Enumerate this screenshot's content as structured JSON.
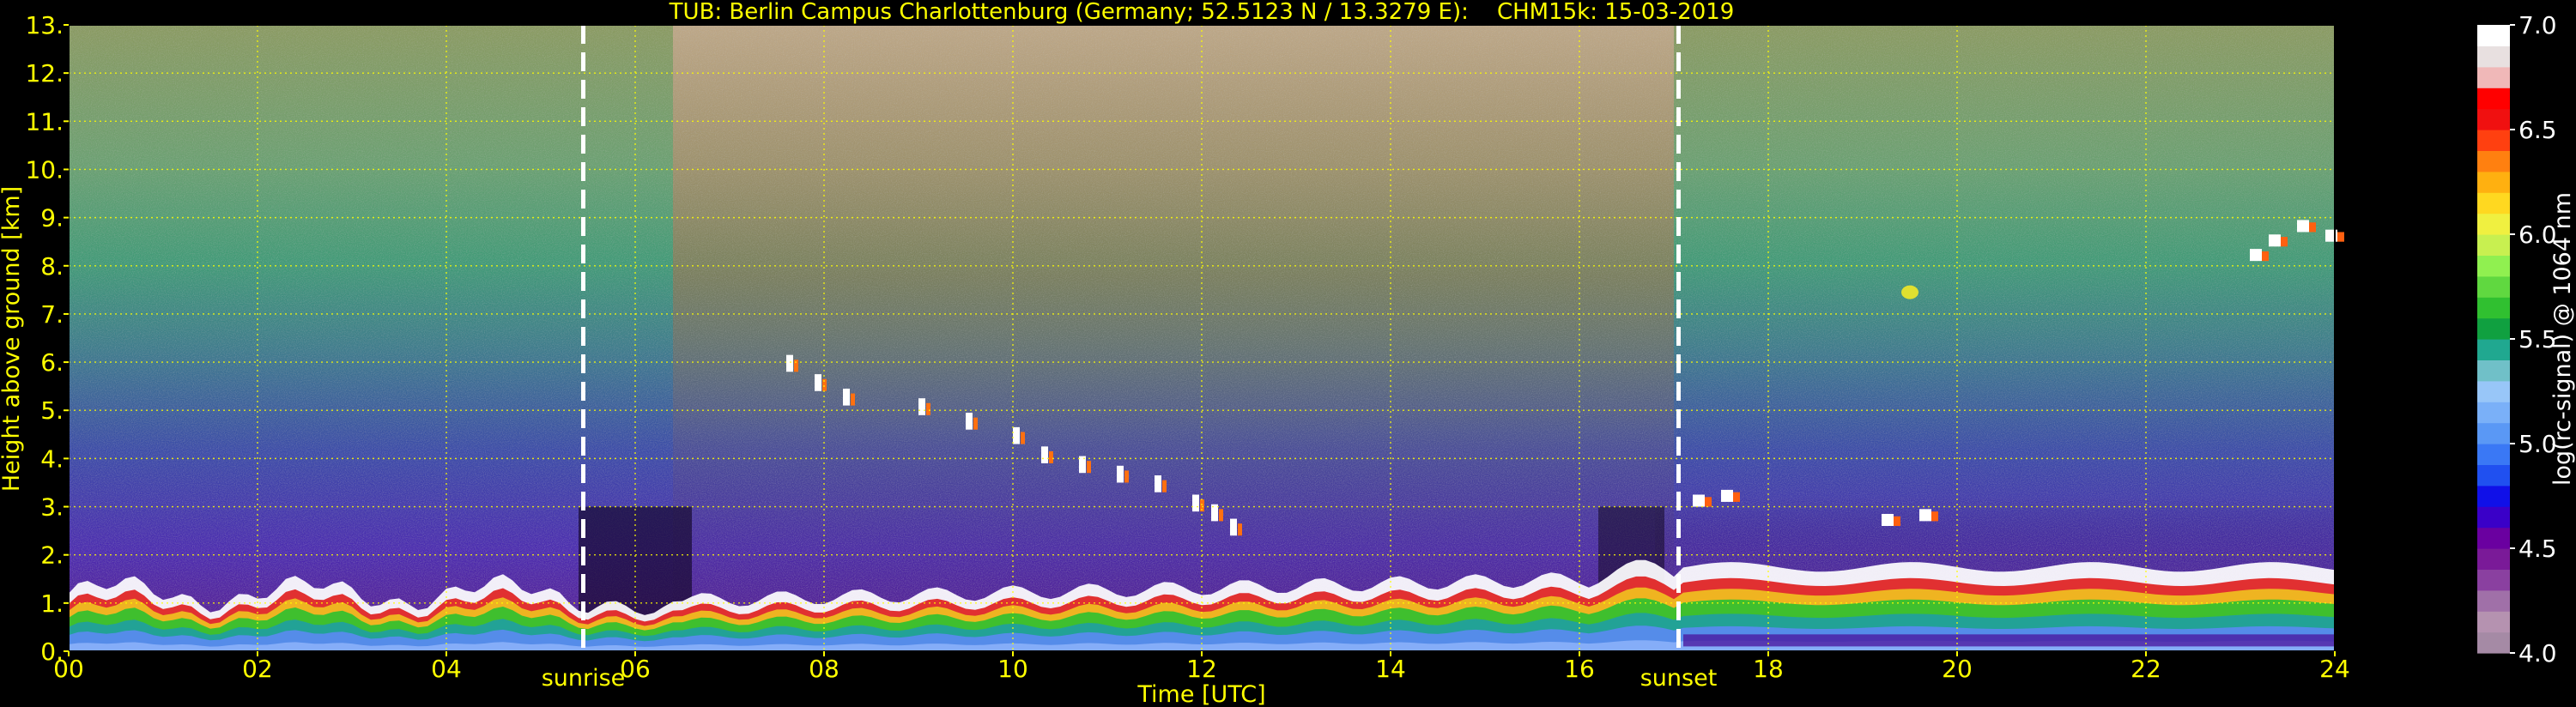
{
  "chart_data": {
    "type": "heatmap",
    "title": "TUB: Berlin Campus Charlottenburg (Germany; 52.5123 N / 13.3279 E):    CHM15k: 15-03-2019",
    "xlabel": "Time [UTC]",
    "ylabel": "Height above ground [km]",
    "xlim": [
      0,
      24
    ],
    "ylim": [
      0,
      13
    ],
    "x_ticks": [
      "00",
      "02",
      "04",
      "06",
      "08",
      "10",
      "12",
      "14",
      "16",
      "18",
      "20",
      "22",
      "24"
    ],
    "y_ticks": [
      "0.",
      "1.",
      "2.",
      "3.",
      "4.",
      "5.",
      "6.",
      "7.",
      "8.",
      "9.",
      "10.",
      "11.",
      "12.",
      "13."
    ],
    "grid": true,
    "colorbar": {
      "label": "log(rc-signal) @ 1064 nm",
      "range": [
        4.0,
        7.0
      ],
      "ticks": [
        "4.0",
        "4.5",
        "5.0",
        "5.5",
        "6.0",
        "6.5",
        "7.0"
      ],
      "colors": [
        "#a58aa5",
        "#b592b0",
        "#a070a8",
        "#8a40a0",
        "#7a1a98",
        "#6a00a0",
        "#3a00c8",
        "#1010e8",
        "#2050f0",
        "#3a78f5",
        "#5a98f5",
        "#7ab0f8",
        "#98c6f8",
        "#70c0c8",
        "#20a890",
        "#10a040",
        "#30c030",
        "#60d840",
        "#90f050",
        "#c8f050",
        "#f0f040",
        "#ffd820",
        "#ffb010",
        "#ff8010",
        "#ff4010",
        "#f01010",
        "#ff0000",
        "#f0b8b8",
        "#e8e0e0",
        "#ffffff"
      ]
    },
    "annotations": [
      {
        "label": "sunrise",
        "x": 5.45
      },
      {
        "label": "sunset",
        "x": 17.05
      }
    ]
  }
}
